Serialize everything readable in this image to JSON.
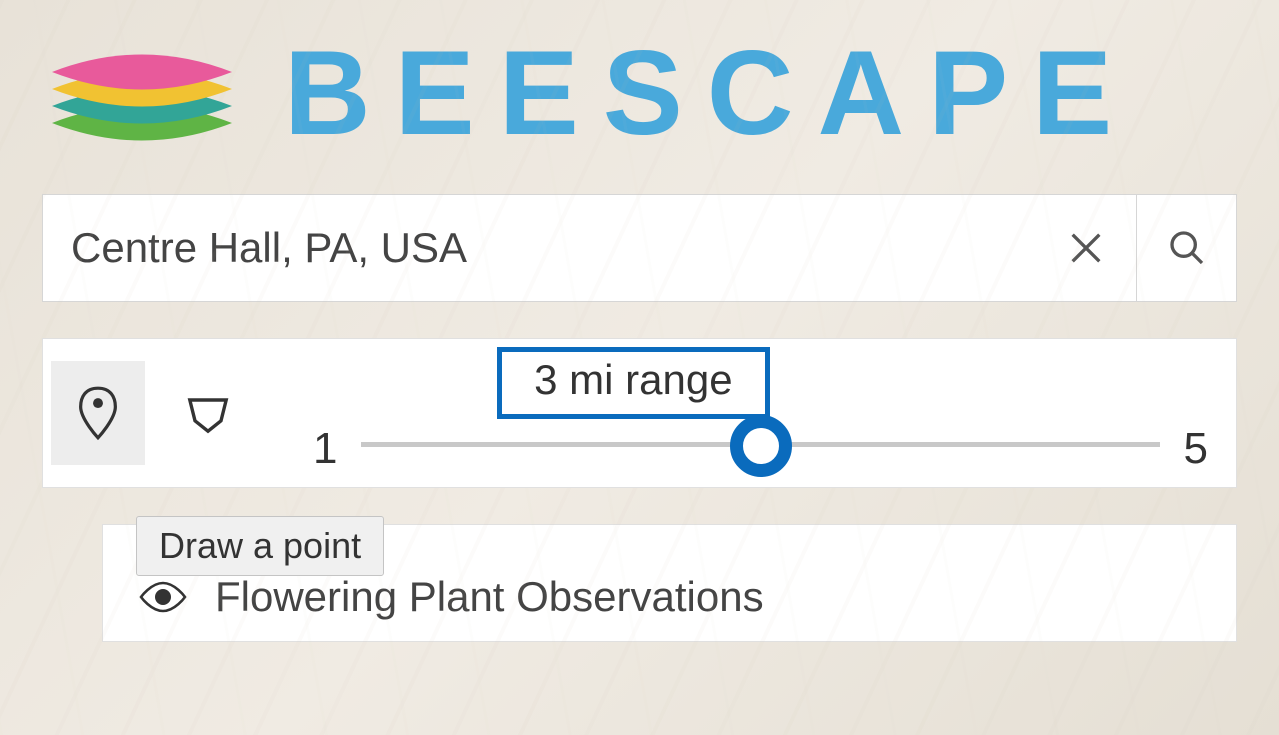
{
  "app": {
    "name": "BEESCAPE"
  },
  "search": {
    "value": "Centre Hall, PA, USA"
  },
  "tools": {
    "point_selected": true,
    "tooltip": "Draw a point"
  },
  "slider": {
    "min": "1",
    "max": "5",
    "value": 3,
    "label": "3 mi range"
  },
  "layers": {
    "items": [
      {
        "label": "Flowering Plant Observations",
        "visible": true
      }
    ]
  }
}
